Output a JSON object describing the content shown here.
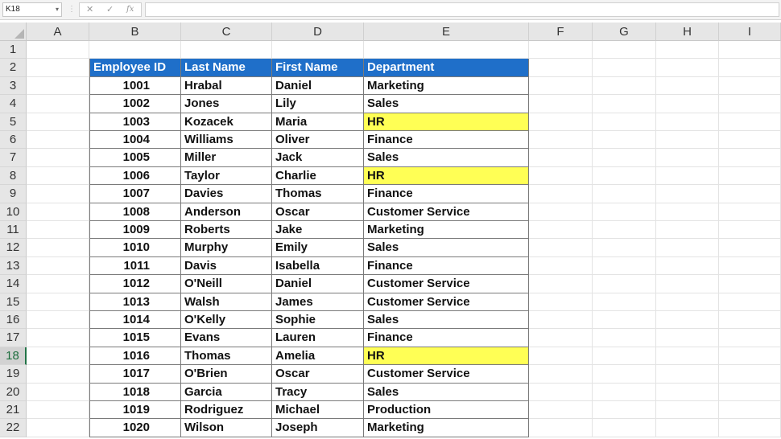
{
  "formula_bar": {
    "name_box": "K18",
    "cancel_icon": "✕",
    "enter_icon": "✓",
    "function_icon": "fx",
    "formula": ""
  },
  "columns": [
    "A",
    "B",
    "C",
    "D",
    "E",
    "F",
    "G",
    "H",
    "I"
  ],
  "rows": [
    "1",
    "2",
    "3",
    "4",
    "5",
    "6",
    "7",
    "8",
    "9",
    "10",
    "11",
    "12",
    "13",
    "14",
    "15",
    "16",
    "17",
    "18",
    "19",
    "20",
    "21",
    "22"
  ],
  "active_row": "18",
  "table": {
    "headers": [
      "Employee ID",
      "Last Name",
      "First Name",
      "Department"
    ],
    "highlight_color": "#ffff55",
    "header_color": "#1f6fc9",
    "records": [
      {
        "id": "1001",
        "last": "Hrabal",
        "first": "Daniel",
        "dept": "Marketing",
        "hl": false
      },
      {
        "id": "1002",
        "last": "Jones",
        "first": "Lily",
        "dept": "Sales",
        "hl": false
      },
      {
        "id": "1003",
        "last": "Kozacek",
        "first": "Maria",
        "dept": "HR",
        "hl": true
      },
      {
        "id": "1004",
        "last": "Williams",
        "first": "Oliver",
        "dept": "Finance",
        "hl": false
      },
      {
        "id": "1005",
        "last": "Miller",
        "first": "Jack",
        "dept": "Sales",
        "hl": false
      },
      {
        "id": "1006",
        "last": "Taylor",
        "first": "Charlie",
        "dept": "HR",
        "hl": true
      },
      {
        "id": "1007",
        "last": "Davies",
        "first": "Thomas",
        "dept": "Finance",
        "hl": false
      },
      {
        "id": "1008",
        "last": "Anderson",
        "first": "Oscar",
        "dept": "Customer Service",
        "hl": false
      },
      {
        "id": "1009",
        "last": "Roberts",
        "first": "Jake",
        "dept": "Marketing",
        "hl": false
      },
      {
        "id": "1010",
        "last": "Murphy",
        "first": "Emily",
        "dept": "Sales",
        "hl": false
      },
      {
        "id": "1011",
        "last": "Davis",
        "first": "Isabella",
        "dept": "Finance",
        "hl": false
      },
      {
        "id": "1012",
        "last": "O'Neill",
        "first": "Daniel",
        "dept": "Customer Service",
        "hl": false
      },
      {
        "id": "1013",
        "last": "Walsh",
        "first": "James",
        "dept": "Customer Service",
        "hl": false
      },
      {
        "id": "1014",
        "last": "O'Kelly",
        "first": "Sophie",
        "dept": "Sales",
        "hl": false
      },
      {
        "id": "1015",
        "last": "Evans",
        "first": "Lauren",
        "dept": "Finance",
        "hl": false
      },
      {
        "id": "1016",
        "last": "Thomas",
        "first": "Amelia",
        "dept": "HR",
        "hl": true
      },
      {
        "id": "1017",
        "last": "O'Brien",
        "first": "Oscar",
        "dept": "Customer Service",
        "hl": false
      },
      {
        "id": "1018",
        "last": "Garcia",
        "first": "Tracy",
        "dept": "Sales",
        "hl": false
      },
      {
        "id": "1019",
        "last": "Rodriguez",
        "first": "Michael",
        "dept": "Production",
        "hl": false
      },
      {
        "id": "1020",
        "last": "Wilson",
        "first": "Joseph",
        "dept": "Marketing",
        "hl": false
      }
    ]
  }
}
